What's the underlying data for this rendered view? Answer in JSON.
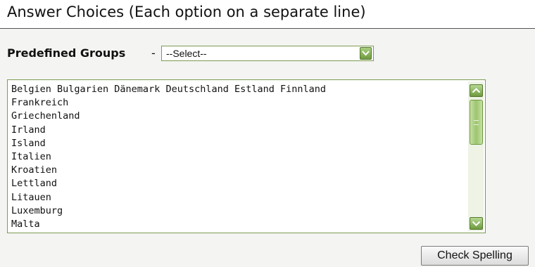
{
  "heading": "Answer Choices (Each option on a separate line)",
  "predefined_groups": {
    "label": "Predefined Groups",
    "separator": "-",
    "selected_value": "--Select--"
  },
  "answer_choices": {
    "lines": [
      "Belgien Bulgarien Dänemark Deutschland Estland Finnland",
      "Frankreich",
      "Griechenland",
      "Irland",
      "Island",
      "Italien",
      "Kroatien",
      "Lettland",
      "Litauen",
      "Luxemburg",
      "Malta"
    ]
  },
  "check_spelling_label": "Check Spelling",
  "colors": {
    "accent_green": "#6f9a3f",
    "border_green": "#7e9a52",
    "panel_background": "#f4f4f2"
  },
  "icons": {
    "dropdown": "chevron-down-icon",
    "scroll_up": "chevron-up-icon",
    "scroll_down": "chevron-down-icon"
  }
}
